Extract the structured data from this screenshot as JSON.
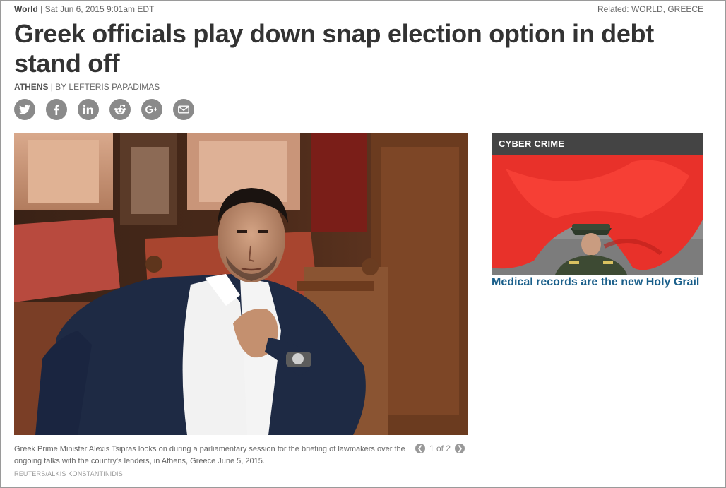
{
  "article": {
    "section": "World",
    "separator": "|",
    "timestamp": "Sat Jun 6, 2015 9:01am EDT",
    "related_label": "Related: ",
    "related_links": [
      "WORLD",
      "GREECE"
    ],
    "headline": "Greek officials play down snap election option in debt stand off",
    "dateline": "ATHENS",
    "byline": "BY LEFTERIS PAPADIMAS"
  },
  "share": {
    "icons": [
      "twitter-icon",
      "facebook-icon",
      "linkedin-icon",
      "reddit-icon",
      "google-plus-icon",
      "email-icon"
    ]
  },
  "photo": {
    "caption": "Greek Prime Minister Alexis Tsipras looks on during a parliamentary session for the briefing of lawmakers over the ongoing talks with the country's lenders, in Athens, Greece June 5, 2015.",
    "credit": "REUTERS/ALKIS KONSTANTINIDIS",
    "pager": "1 of 2"
  },
  "promo": {
    "category": "CYBER CRIME",
    "title": "Medical records are the new Holy Grail"
  },
  "colors": {
    "link": "#1a5f8a",
    "promo_header_bg": "#444444",
    "share_icon_bg": "#8a8a8a"
  }
}
